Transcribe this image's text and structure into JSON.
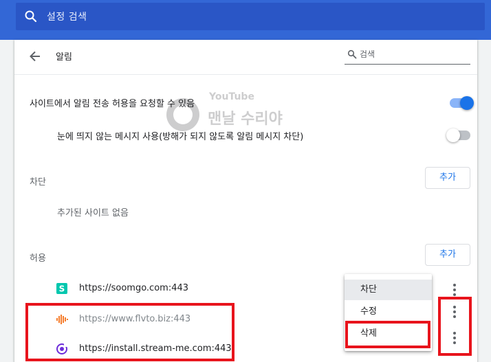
{
  "search": {
    "label": "설정 검색"
  },
  "header": {
    "title": "알림",
    "search_placeholder": "검색"
  },
  "settings": {
    "ask_label": "사이트에서 알림 전송 허용을 요청할 수 있음",
    "ask_enabled": true,
    "quiet_label": "눈에 띄지 않는 메시지 사용(방해가 되지 않도록 알림 메시지 차단)",
    "quiet_enabled": false
  },
  "block": {
    "label": "차단",
    "add_label": "추가",
    "empty_text": "추가된 사이트 없음"
  },
  "allow": {
    "label": "허용",
    "add_label": "추가",
    "sites": [
      {
        "url": "https://soomgo.com:443",
        "icon": "soomgo-favicon-icon",
        "color": "#00c7ae"
      },
      {
        "url": "https://www.flvto.biz:443",
        "icon": "flvto-favicon-icon",
        "color": "#f57c2b"
      },
      {
        "url": "https://install.stream-me.com:443",
        "icon": "streamme-favicon-icon",
        "color": "#6c2bd9"
      }
    ]
  },
  "context_menu": {
    "items": [
      "차단",
      "수정",
      "삭제"
    ]
  },
  "watermark": {
    "brand": "YouTube",
    "title": "맨날 수리야"
  },
  "colors": {
    "topbar": "#3367d6",
    "accent": "#1a73e8",
    "highlight": "#e8141c"
  }
}
